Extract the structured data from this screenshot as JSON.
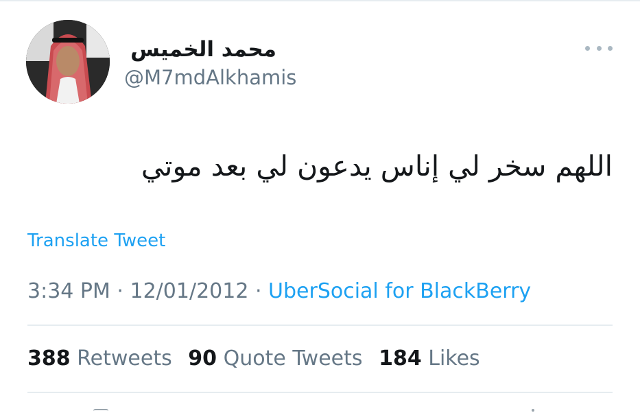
{
  "tweet": {
    "author": {
      "display_name": "محمد الخميس",
      "handle": "@M7mdAlkhamis"
    },
    "text": "اللهم سخر لي إناس يدعون لي بعد موتي",
    "translate_label": "Translate Tweet",
    "time": "3:34 PM",
    "date": "12/01/2012",
    "separator": " · ",
    "source": "UberSocial for BlackBerry"
  },
  "stats": {
    "retweets_count": "388",
    "retweets_label": "Retweets",
    "quotes_count": "90",
    "quotes_label": "Quote Tweets",
    "likes_count": "184",
    "likes_label": "Likes"
  },
  "colors": {
    "link": "#1da1f2",
    "secondary_text": "#657786",
    "primary_text": "#14171a",
    "divider": "#e6ecf0"
  },
  "icons": {
    "more": "more-horizontal-icon",
    "avatar": "profile-photo"
  }
}
